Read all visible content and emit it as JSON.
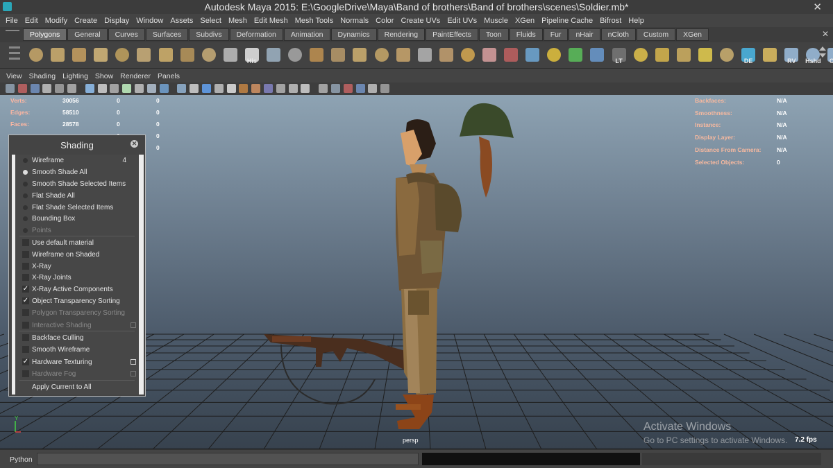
{
  "window": {
    "title": "Autodesk Maya 2015: E:\\GoogleDrive\\Maya\\Band of brothers\\Band of brothers\\scenes\\Soldier.mb*",
    "close_glyph": "✕"
  },
  "main_menu": [
    "File",
    "Edit",
    "Modify",
    "Create",
    "Display",
    "Window",
    "Assets",
    "Select",
    "Mesh",
    "Edit Mesh",
    "Mesh Tools",
    "Normals",
    "Color",
    "Create UVs",
    "Edit UVs",
    "Muscle",
    "XGen",
    "Pipeline Cache",
    "Bifrost",
    "Help"
  ],
  "shelf_tabs": [
    "Polygons",
    "General",
    "Curves",
    "Surfaces",
    "Subdivs",
    "Deformation",
    "Animation",
    "Dynamics",
    "Rendering",
    "PaintEffects",
    "Toon",
    "Fluids",
    "Fur",
    "nHair",
    "nCloth",
    "Custom",
    "XGen"
  ],
  "shelf_tab_close": "✕",
  "active_shelf_tab": "Polygons",
  "shelf_icons": [
    {
      "name": "sphere",
      "label": ""
    },
    {
      "name": "cube",
      "label": ""
    },
    {
      "name": "cylinder",
      "label": ""
    },
    {
      "name": "cone",
      "label": ""
    },
    {
      "name": "plane",
      "label": ""
    },
    {
      "name": "torus",
      "label": ""
    },
    {
      "name": "pyramid",
      "label": ""
    },
    {
      "name": "pipe",
      "label": ""
    },
    {
      "name": "helix",
      "label": ""
    },
    {
      "name": "soccer-ball",
      "label": ""
    },
    {
      "name": "history",
      "label": "His"
    },
    {
      "name": "combine",
      "label": ""
    },
    {
      "name": "separate",
      "label": ""
    },
    {
      "name": "extract",
      "label": ""
    },
    {
      "name": "smooth",
      "label": ""
    },
    {
      "name": "extrude",
      "label": ""
    },
    {
      "name": "bridge",
      "label": ""
    },
    {
      "name": "append",
      "label": ""
    },
    {
      "name": "split",
      "label": ""
    },
    {
      "name": "insert-edge",
      "label": ""
    },
    {
      "name": "offset-edge",
      "label": ""
    },
    {
      "name": "sculpt",
      "label": ""
    },
    {
      "name": "paint",
      "label": ""
    },
    {
      "name": "grid",
      "label": ""
    },
    {
      "name": "target",
      "label": ""
    },
    {
      "name": "color-wheel",
      "label": ""
    },
    {
      "name": "mirror",
      "label": ""
    },
    {
      "name": "lattice",
      "label": "LT"
    },
    {
      "name": "uv-editor",
      "label": ""
    },
    {
      "name": "uv-layout",
      "label": ""
    },
    {
      "name": "uv-planar",
      "label": ""
    },
    {
      "name": "uv-auto",
      "label": ""
    },
    {
      "name": "uv-unfold",
      "label": ""
    },
    {
      "name": "delete-edge",
      "label": "DE"
    },
    {
      "name": "uv-snapshot",
      "label": ""
    },
    {
      "name": "render-view",
      "label": "RV"
    },
    {
      "name": "hypershade",
      "label": "Hshd"
    },
    {
      "name": "outliner",
      "label": "Out"
    }
  ],
  "panel_menu": [
    "View",
    "Shading",
    "Lighting",
    "Show",
    "Renderer",
    "Panels"
  ],
  "hud_left": {
    "labels": [
      "Verts:",
      "Edges:",
      "Faces:"
    ],
    "col1": [
      "30056",
      "58510",
      "28578",
      "",
      ""
    ],
    "col2": [
      "0",
      "0",
      "0",
      "0",
      "0"
    ],
    "col3": [
      "0",
      "0",
      "0",
      "0",
      "0"
    ]
  },
  "hud_right": [
    {
      "label": "Backfaces:",
      "value": "N/A"
    },
    {
      "label": "Smoothness:",
      "value": "N/A"
    },
    {
      "label": "Instance:",
      "value": "N/A"
    },
    {
      "label": "Display Layer:",
      "value": "N/A"
    },
    {
      "label": "Distance From Camera:",
      "value": "N/A"
    },
    {
      "label": "Selected Objects:",
      "value": "0"
    }
  ],
  "shading_menu": {
    "title": "Shading",
    "close_glyph": "✕",
    "items": [
      {
        "label": "Wireframe",
        "kind": "radio",
        "on": false,
        "hotkey": "4"
      },
      {
        "label": "Smooth Shade All",
        "kind": "radio",
        "on": true
      },
      {
        "label": "Smooth Shade Selected Items",
        "kind": "radio",
        "on": false
      },
      {
        "label": "Flat Shade All",
        "kind": "radio",
        "on": false
      },
      {
        "label": "Flat Shade Selected Items",
        "kind": "radio",
        "on": false
      },
      {
        "label": "Bounding Box",
        "kind": "radio",
        "on": false
      },
      {
        "label": "Points",
        "kind": "radio",
        "on": false,
        "dim": true
      },
      {
        "label": "Use default material",
        "kind": "check",
        "on": false
      },
      {
        "label": "Wireframe on Shaded",
        "kind": "check",
        "on": false
      },
      {
        "label": "X-Ray",
        "kind": "check",
        "on": false
      },
      {
        "label": "X-Ray Joints",
        "kind": "check",
        "on": false
      },
      {
        "label": "X-Ray Active Components",
        "kind": "check",
        "on": true
      },
      {
        "label": "Object Transparency Sorting",
        "kind": "check",
        "on": true
      },
      {
        "label": "Polygon Transparency Sorting",
        "kind": "check",
        "on": false,
        "dim": true
      },
      {
        "label": "Interactive Shading",
        "kind": "check",
        "on": false,
        "dim": true,
        "option": true
      },
      {
        "label": "Backface Culling",
        "kind": "check",
        "on": false
      },
      {
        "label": "Smooth Wireframe",
        "kind": "check",
        "on": false
      },
      {
        "label": "Hardware Texturing",
        "kind": "check",
        "on": true,
        "option": true
      },
      {
        "label": "Hardware Fog",
        "kind": "check",
        "on": false,
        "dim": true,
        "option": true
      },
      {
        "label": "Apply Current to All",
        "kind": "plain"
      }
    ]
  },
  "viewport": {
    "camera": "persp",
    "fps": "7.2 fps",
    "axis_label": "Y"
  },
  "watermark": {
    "line1": "Activate Windows",
    "line2": "Go to PC settings to activate Windows."
  },
  "command_line": {
    "language": "Python"
  },
  "colors": {
    "menu_bg": "#444444",
    "viewport_top": "#8ea3b3",
    "viewport_bottom": "#37424e",
    "hud_label": "#ffb7a2",
    "accent_cyan": "#2aa7b8"
  }
}
